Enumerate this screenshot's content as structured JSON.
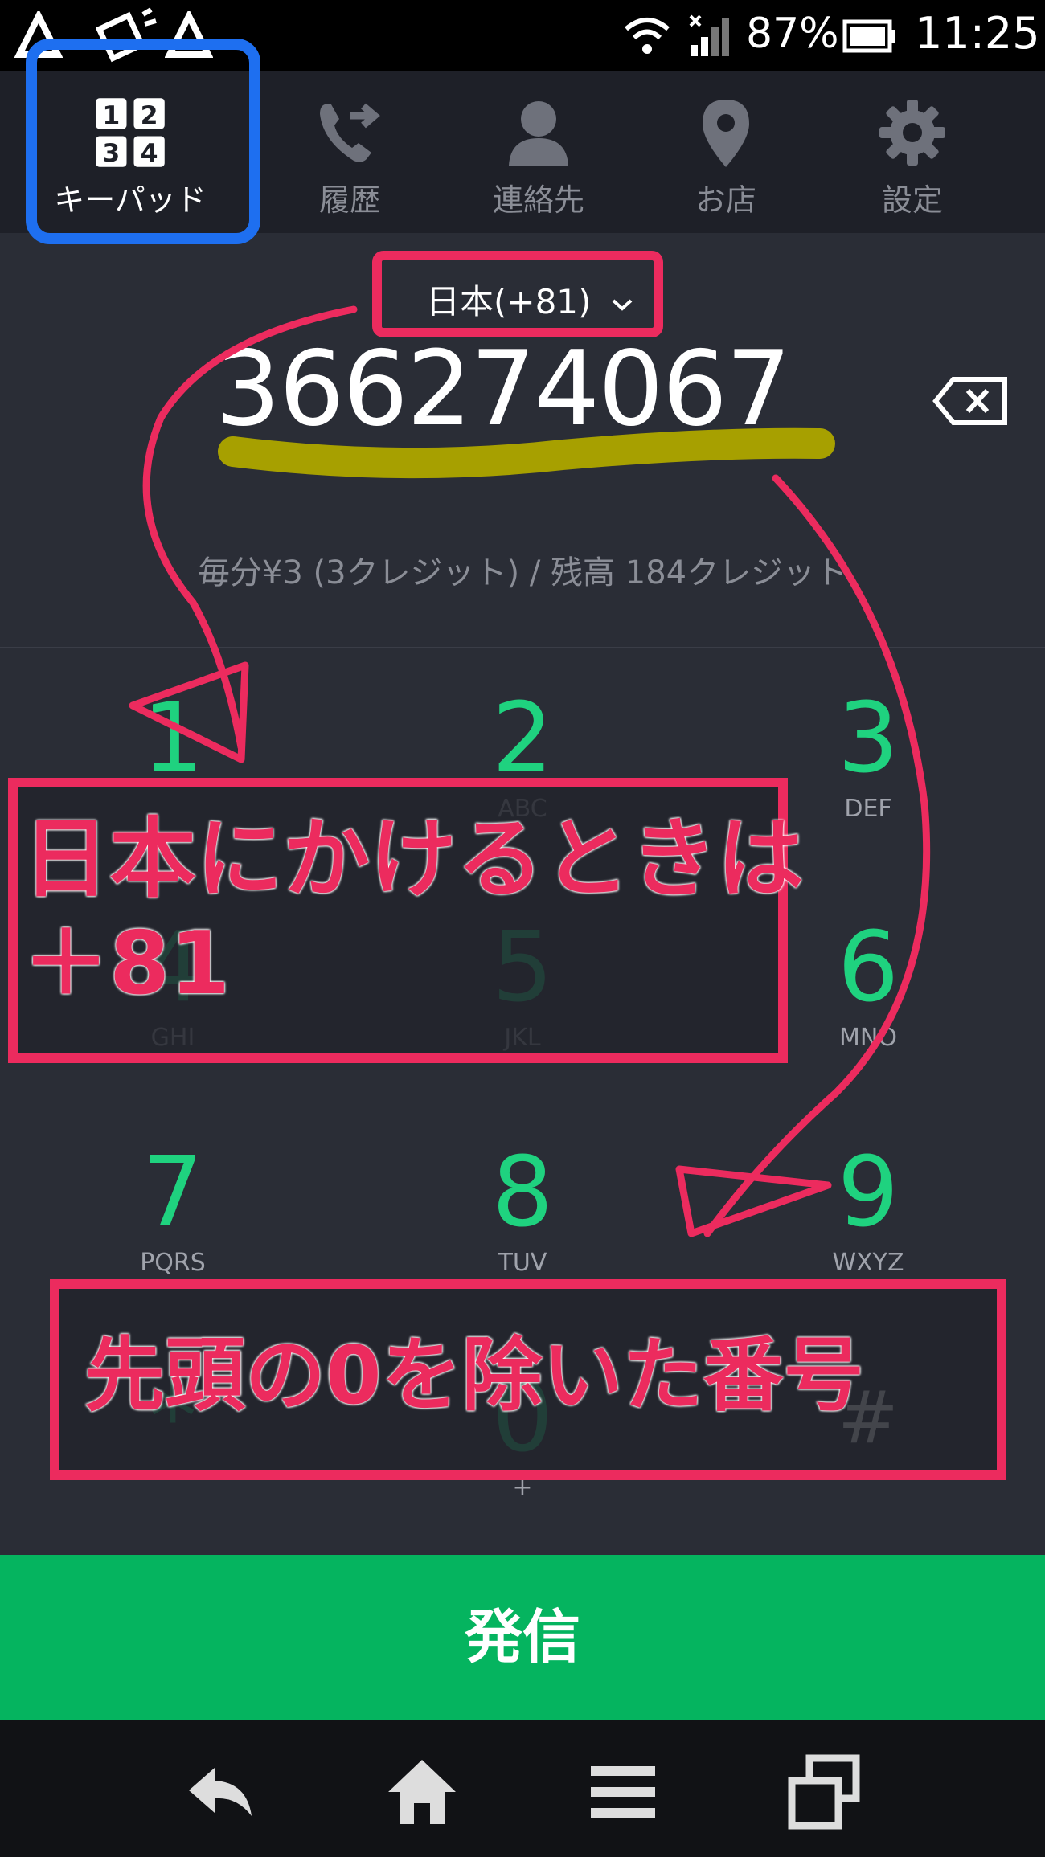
{
  "status_bar": {
    "battery": "87%",
    "time": "11:25"
  },
  "tabs": [
    {
      "label": "キーパッド",
      "icon": "keypad-icon",
      "active": true
    },
    {
      "label": "履歴",
      "icon": "call-history-icon",
      "active": false
    },
    {
      "label": "連絡先",
      "icon": "contact-person-icon",
      "active": false
    },
    {
      "label": "お店",
      "icon": "location-pin-icon",
      "active": false
    },
    {
      "label": "設定",
      "icon": "gear-icon",
      "active": false
    }
  ],
  "keypad_icon_digits": [
    "1",
    "2",
    "3",
    "4"
  ],
  "dialer": {
    "country": "日本(+81)",
    "number": "366274067",
    "rate": "毎分¥3 (3クレジット) / 残高 184クレジット"
  },
  "keys": [
    {
      "digit": "1",
      "letters": ""
    },
    {
      "digit": "2",
      "letters": "ABC"
    },
    {
      "digit": "3",
      "letters": "DEF"
    },
    {
      "digit": "4",
      "letters": "GHI"
    },
    {
      "digit": "5",
      "letters": "JKL"
    },
    {
      "digit": "6",
      "letters": "MNO"
    },
    {
      "digit": "7",
      "letters": "PQRS"
    },
    {
      "digit": "8",
      "letters": "TUV"
    },
    {
      "digit": "9",
      "letters": "WXYZ"
    },
    {
      "digit": "*",
      "letters": ""
    },
    {
      "digit": "0",
      "letters": "+"
    },
    {
      "digit": "#",
      "letters": ""
    }
  ],
  "call_button": {
    "label": "発信"
  },
  "annotations": {
    "note1_line1": "日本にかけるときは",
    "note1_line2": "＋81",
    "note2": "先頭の0を除いた番号"
  },
  "colors": {
    "accent_green": "#1fd27f",
    "call_green": "#05b45f",
    "annotation_pink": "#ec2b5e",
    "annotation_blue": "#1e6ff0",
    "highlight_olive": "#a7a000"
  }
}
